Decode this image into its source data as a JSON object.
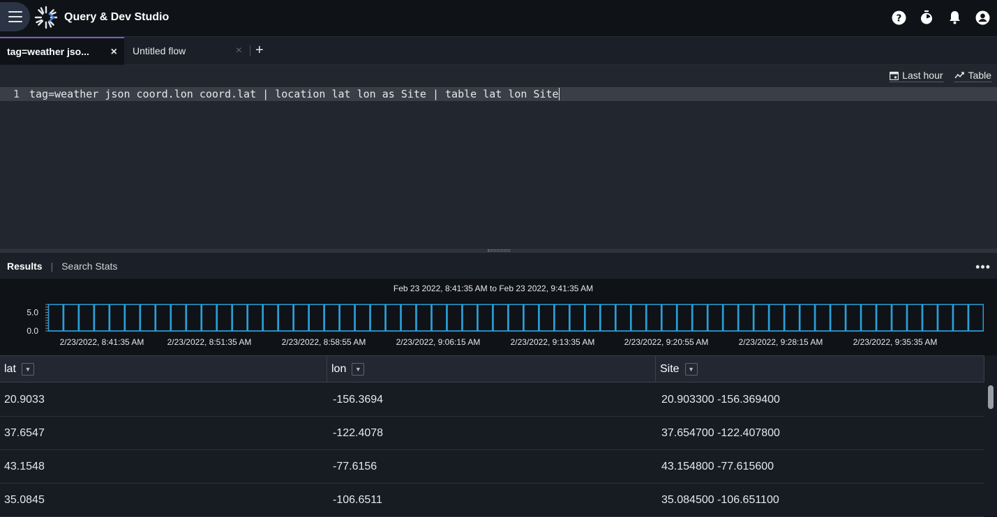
{
  "app": {
    "title": "Query & Dev Studio"
  },
  "colors": {
    "accent": "#7e57c2",
    "bar": "#2aa0d8"
  },
  "top_icons": [
    "help-icon",
    "timer-icon",
    "bell-icon",
    "account-icon"
  ],
  "tabs": [
    {
      "label": "tag=weather jso...",
      "close": "×",
      "active": true
    },
    {
      "label": "Untitled flow",
      "close": "×",
      "active": false
    }
  ],
  "add_tab_label": "+",
  "editor": {
    "toolbar": {
      "time_range": "Last hour",
      "render": "Table"
    },
    "line_number": "1",
    "query": "tag=weather json coord.lon coord.lat | location lat lon as Site | table lat lon Site"
  },
  "results": {
    "results_tab": "Results",
    "separator": "|",
    "stats_tab": "Search Stats",
    "more": "•••"
  },
  "chart_data": {
    "type": "bar",
    "title": "Feb 23 2022, 8:41:35 AM to Feb 23 2022, 9:41:35 AM",
    "y_ticks": [
      "5.0",
      "0.0"
    ],
    "ylim": [
      0,
      5.0
    ],
    "x_tick_labels": [
      "2/23/2022, 8:41:35 AM",
      "2/23/2022, 8:51:35 AM",
      "2/23/2022, 8:58:55 AM",
      "2/23/2022, 9:06:15 AM",
      "2/23/2022, 9:13:35 AM",
      "2/23/2022, 9:20:55 AM",
      "2/23/2022, 9:28:15 AM",
      "2/23/2022, 9:35:35 AM"
    ],
    "values": [
      5,
      5,
      5,
      5,
      5,
      5,
      5,
      5,
      5,
      5,
      5,
      5,
      5,
      5,
      5,
      5,
      5,
      5,
      5,
      5,
      5,
      5,
      5,
      5,
      5,
      5,
      5,
      5,
      5,
      5,
      5,
      5,
      5,
      5,
      5,
      5,
      5,
      5,
      5,
      5,
      5,
      5,
      5,
      5,
      5,
      5,
      5,
      5,
      5,
      5,
      5,
      5,
      5,
      5,
      5,
      5,
      5,
      5,
      5,
      5,
      5
    ]
  },
  "table": {
    "columns": [
      "lat",
      "lon",
      "Site"
    ],
    "filter_icon": "▼",
    "rows": [
      [
        "20.9033",
        "-156.3694",
        "20.903300 -156.369400"
      ],
      [
        "37.6547",
        "-122.4078",
        "37.654700 -122.407800"
      ],
      [
        "43.1548",
        "-77.6156",
        "43.154800 -77.615600"
      ],
      [
        "35.0845",
        "-106.6511",
        "35.084500 -106.651100"
      ]
    ]
  }
}
